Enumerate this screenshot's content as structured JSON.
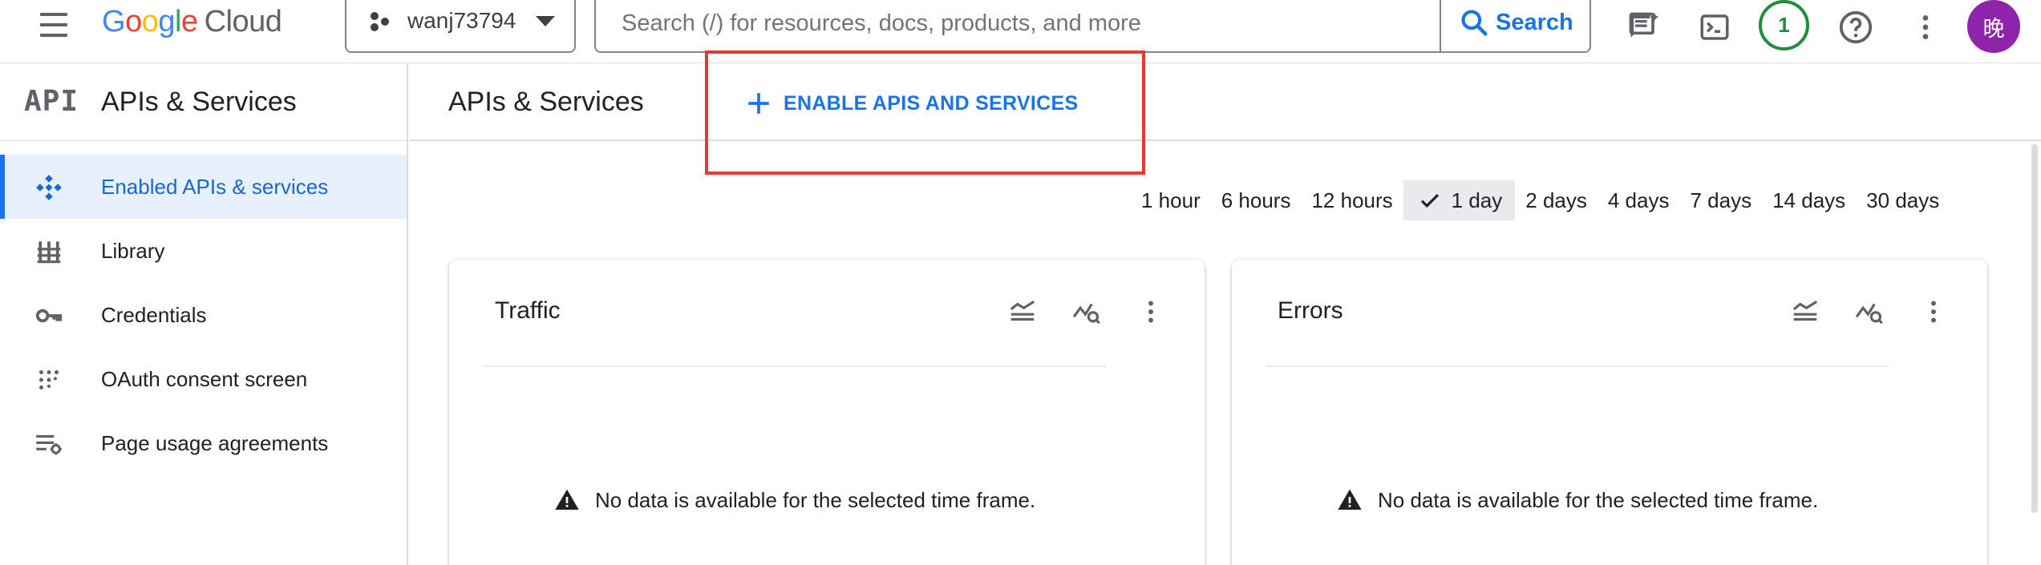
{
  "topbar": {
    "logo_google": "Google",
    "logo_cloud": "Cloud",
    "project_name": "wanj73794",
    "search_placeholder": "Search (/) for resources, docs, products, and more",
    "search_button": "Search",
    "notification_count": "1",
    "avatar_initial": "晚",
    "icons": [
      "menu-icon",
      "gemini-chat-icon",
      "cloud-shell-icon",
      "help-icon",
      "more-vert-icon"
    ]
  },
  "sidebar": {
    "logo_text": "API",
    "title": "APIs & Services",
    "items": [
      {
        "label": "Enabled APIs & services",
        "icon": "enabled-apis-icon",
        "active": true
      },
      {
        "label": "Library",
        "icon": "library-icon",
        "active": false
      },
      {
        "label": "Credentials",
        "icon": "key-icon",
        "active": false
      },
      {
        "label": "OAuth consent screen",
        "icon": "oauth-dots-icon",
        "active": false
      },
      {
        "label": "Page usage agreements",
        "icon": "settings-list-icon",
        "active": false
      }
    ]
  },
  "main": {
    "title": "APIs & Services",
    "enable_button": "ENABLE APIS AND SERVICES",
    "time_range": {
      "options": [
        "1 hour",
        "6 hours",
        "12 hours",
        "1 day",
        "2 days",
        "4 days",
        "7 days",
        "14 days",
        "30 days"
      ],
      "selected": "1 day"
    },
    "cards": [
      {
        "title": "Traffic",
        "message": "No data is available for the selected time frame."
      },
      {
        "title": "Errors",
        "message": "No data is available for the selected time frame."
      }
    ]
  },
  "colors": {
    "accent": "#1a73e8",
    "highlight": "#e53935",
    "avatar": "#8e24aa",
    "notification": "#1e8e3e"
  }
}
